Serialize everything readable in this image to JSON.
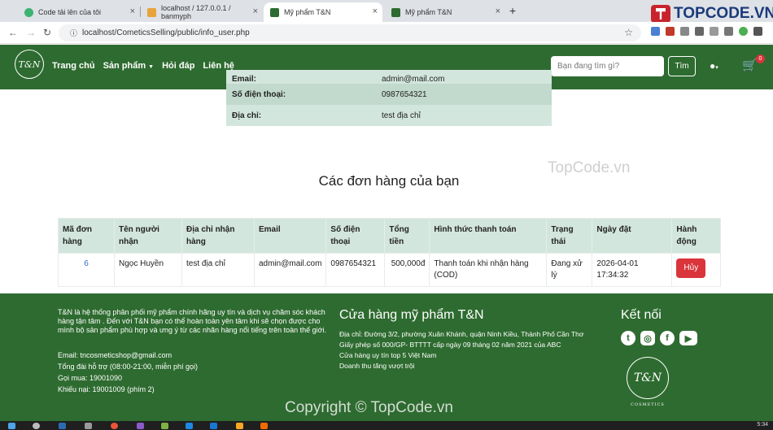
{
  "browser": {
    "tabs": [
      {
        "label": "Code tải lên của tôi",
        "active": false
      },
      {
        "label": "localhost / 127.0.0.1 / banmyph",
        "active": false
      },
      {
        "label": "Mỹ phẩm T&N",
        "active": true
      },
      {
        "label": "Mỹ phẩm T&N",
        "active": false
      }
    ],
    "url": "localhost/CometicsSelling/public/info_user.php",
    "brand_logo_text": "TOPCODE.VN"
  },
  "header": {
    "logo_text": "T&N",
    "logo_subtext": "COSMETICS",
    "menu": [
      {
        "label": "Trang chủ",
        "caret": false
      },
      {
        "label": "Sản phẩm",
        "caret": true
      },
      {
        "label": "Hỏi đáp",
        "caret": false
      },
      {
        "label": "Liên hệ",
        "caret": false
      }
    ],
    "search_placeholder": "Bạn đang tìm gì?",
    "search_button": "Tìm",
    "cart_count": "0"
  },
  "user_info": [
    {
      "label": "Email:",
      "value": "admin@mail.com"
    },
    {
      "label": "Số điện thoại:",
      "value": "0987654321"
    },
    {
      "label": "Địa chỉ:",
      "value": "test địa chỉ"
    }
  ],
  "orders": {
    "title": "Các đơn hàng của bạn",
    "columns": [
      "Mã đơn hàng",
      "Tên người nhận",
      "Địa chỉ nhận hàng",
      "Email",
      "Số điện thoại",
      "Tổng tiền",
      "Hình thức thanh toán",
      "Trạng thái",
      "Ngày đặt",
      "Hành động"
    ],
    "rows": [
      {
        "id": "6",
        "name": "Ngọc Huyền",
        "address": "test địa chỉ",
        "email": "admin@mail.com",
        "phone": "0987654321",
        "total": "500,000đ",
        "payment": "Thanh toán khi nhận hàng (COD)",
        "status": "Đang xử lý",
        "date": "2026-04-01 17:34:32",
        "action": "Hủy"
      }
    ]
  },
  "footer": {
    "about": "T&N là hệ thống phân phối mỹ phẩm chính hãng uy tín và dịch vụ chăm sóc khách hàng tận tâm . Đến với T&N bạn có thể hoàn toàn yên tâm khi sẽ chọn được cho mình bộ sản phẩm phù hợp và ưng ý từ các nhãn hàng nổi tiếng trên toàn thế giới.",
    "contacts": [
      "Email: tncosmeticshop@gmail.com",
      "Tổng đài hỗ trợ (08:00-21:00, miễn phí gọi)",
      "Gọi mua: 19001090",
      "Khiếu nại: 19001009 (phím 2)"
    ],
    "store_title": "Cửa hàng mỹ phẩm T&N",
    "store_lines": [
      "Địa chỉ: Đường 3/2, phường Xuân Khánh, quận Ninh Kiều, Thành Phố Cần Thơ",
      "Giấy phép số 000/GP- BTTTT cấp ngày 09 tháng 02 năm 2021 của ABC",
      "Cửa hàng uy tín top 5 Việt Nam",
      "Doanh thu tăng vượt trội"
    ],
    "connect_title": "Kết nối",
    "logo_text": "T&N",
    "logo_subtext": "COSMETICS"
  },
  "watermarks": [
    "Copyright © TopCode.vn",
    "TopCode.vn"
  ],
  "taskbar": {
    "clock": "5:34"
  },
  "colors": {
    "brand_green": "#2e6b30",
    "row_light": "#d3e6dd",
    "danger": "#d9353a",
    "link": "#2f6fc7"
  }
}
